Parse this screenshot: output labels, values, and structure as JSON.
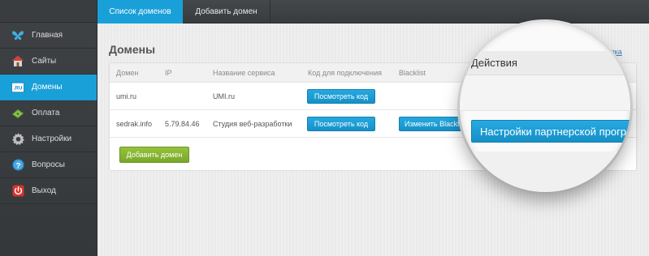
{
  "sidebar": {
    "items": [
      {
        "label": "Главная",
        "icon": "butterfly-icon"
      },
      {
        "label": "Сайты",
        "icon": "house-icon"
      },
      {
        "label": "Домены",
        "icon": "ru-domain-icon"
      },
      {
        "label": "Оплата",
        "icon": "money-icon"
      },
      {
        "label": "Настройки",
        "icon": "gear-icon"
      },
      {
        "label": "Вопросы",
        "icon": "question-icon"
      },
      {
        "label": "Выход",
        "icon": "power-icon"
      }
    ],
    "active_index": 2
  },
  "tabs": [
    {
      "label": "Список доменов",
      "active": true
    },
    {
      "label": "Добавить домен",
      "active": false
    }
  ],
  "page": {
    "title": "Домены",
    "help_link": "подсказка"
  },
  "table": {
    "columns": [
      "Домен",
      "IP",
      "Название сервиса",
      "Код для подключения",
      "Blacklist"
    ],
    "rows": [
      {
        "domain": "umi.ru",
        "ip": "",
        "service": "UMI.ru",
        "code_button": "Посмотреть код",
        "blacklist_button": ""
      },
      {
        "domain": "sedrak.info",
        "ip": "5.79.84.46",
        "service": "Студия веб-разработки",
        "code_button": "Посмотреть код",
        "blacklist_button": "Изменить Blacklist"
      }
    ],
    "add_button": "Добавить домен"
  },
  "magnifier": {
    "column_label": "Действия",
    "button_label": "Настройки партнерской программы"
  },
  "colors": {
    "accent": "#1aa0d8",
    "green": "#8ab733",
    "sidebar_bg": "#3c3f42"
  }
}
